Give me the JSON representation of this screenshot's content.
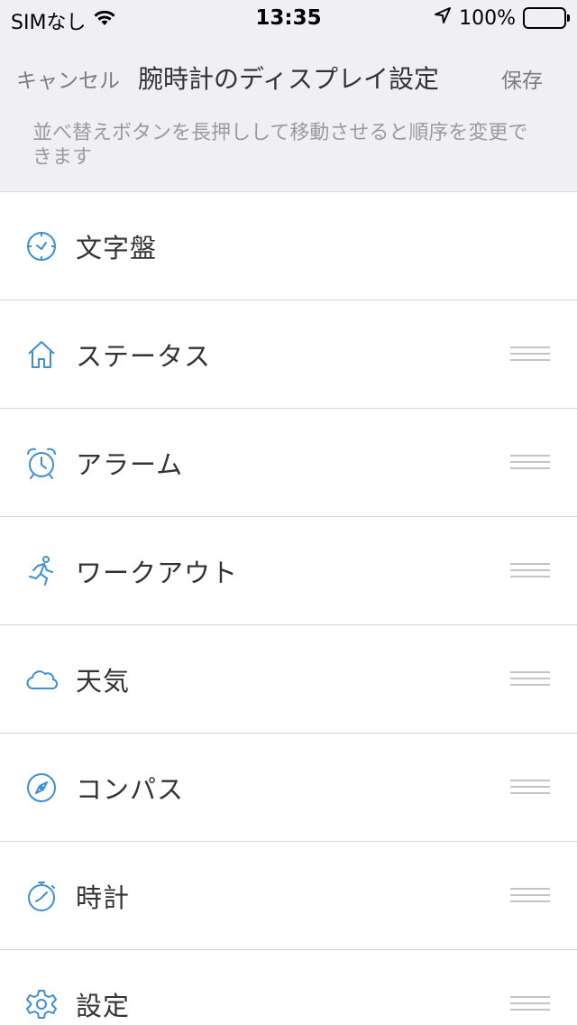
{
  "status_bar": {
    "carrier": "SIMなし",
    "time": "13:35",
    "battery": "100%"
  },
  "nav": {
    "cancel": "キャンセル",
    "title": "腕時計のディスプレイ設定",
    "save": "保存"
  },
  "hint": "並べ替えボタンを長押しして移動させると順序を変更できます",
  "items": [
    {
      "label": "文字盤",
      "icon": "watch-face-icon",
      "draggable": false
    },
    {
      "label": "ステータス",
      "icon": "home-icon",
      "draggable": true
    },
    {
      "label": "アラーム",
      "icon": "alarm-clock-icon",
      "draggable": true
    },
    {
      "label": "ワークアウト",
      "icon": "running-person-icon",
      "draggable": true
    },
    {
      "label": "天気",
      "icon": "cloud-icon",
      "draggable": true
    },
    {
      "label": "コンパス",
      "icon": "compass-icon",
      "draggable": true
    },
    {
      "label": "時計",
      "icon": "stopwatch-icon",
      "draggable": true
    },
    {
      "label": "設定",
      "icon": "gear-icon",
      "draggable": true
    }
  ],
  "colors": {
    "accent": "#3e8fd6",
    "header_bg": "#efeff4",
    "divider": "#d6d6da"
  }
}
